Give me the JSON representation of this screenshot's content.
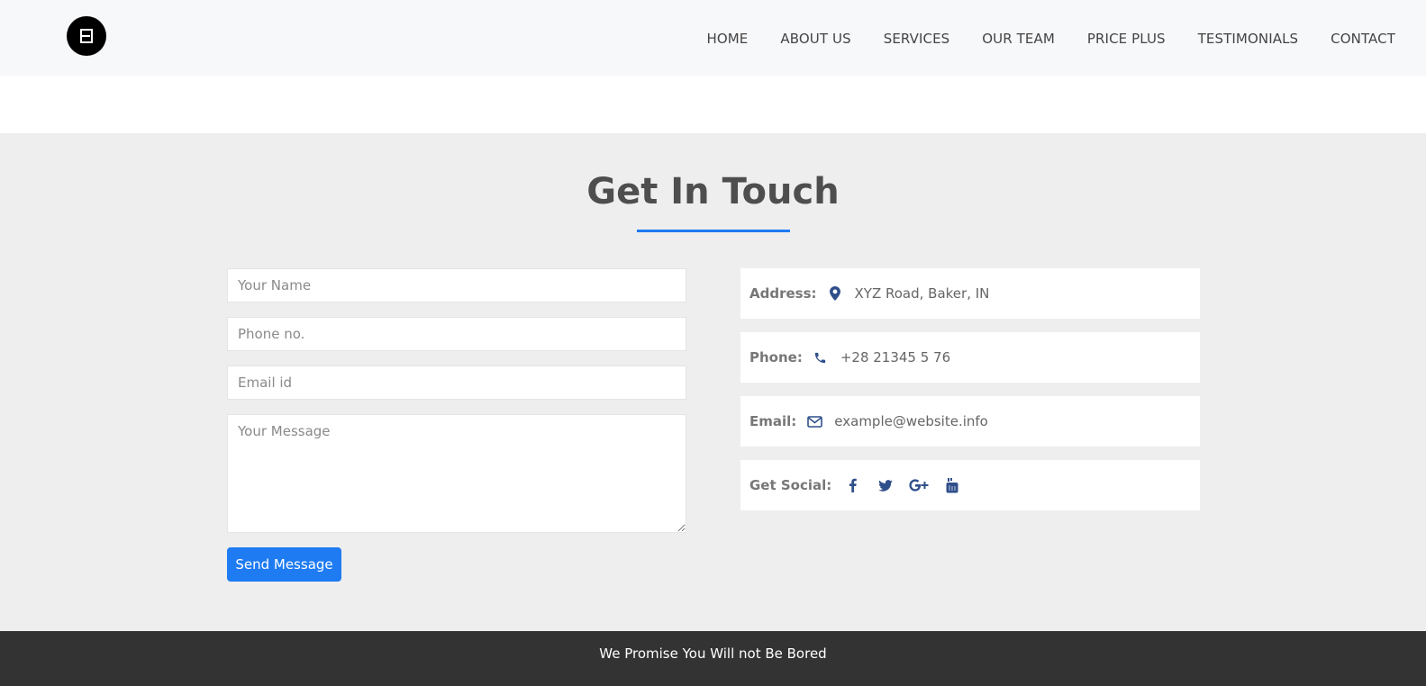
{
  "colors": {
    "accent": "#1e7bf2",
    "icon": "#2f4f8a",
    "section_bg": "#eeeeee",
    "footer_bg": "#333333",
    "navbar_bg": "#f7f8fa"
  },
  "logo": {
    "icon": "brand-logo-icon"
  },
  "nav": {
    "items": [
      "HOME",
      "ABOUT US",
      "SERVICES",
      "OUR TEAM",
      "PRICE PLUS",
      "TESTIMONIALS",
      "CONTACT"
    ]
  },
  "contact": {
    "title": "Get In Touch",
    "form": {
      "name_placeholder": "Your Name",
      "phone_placeholder": "Phone no.",
      "email_placeholder": "Email id",
      "message_placeholder": "Your Message",
      "send_label": "Send Message"
    },
    "info": {
      "address": {
        "label": "Address:",
        "icon": "map-marker-icon",
        "value": "XYZ Road, Baker, IN"
      },
      "phone": {
        "label": "Phone:",
        "icon": "phone-icon",
        "value": "+28 21345 5 76"
      },
      "email": {
        "label": "Email:",
        "icon": "envelope-icon",
        "value": "example@website.info"
      },
      "social": {
        "label": "Get Social:",
        "icons": [
          "facebook-icon",
          "twitter-icon",
          "google-plus-icon",
          "youtube-icon"
        ]
      }
    }
  },
  "footer": {
    "text": "We Promise You Will not Be Bored"
  }
}
